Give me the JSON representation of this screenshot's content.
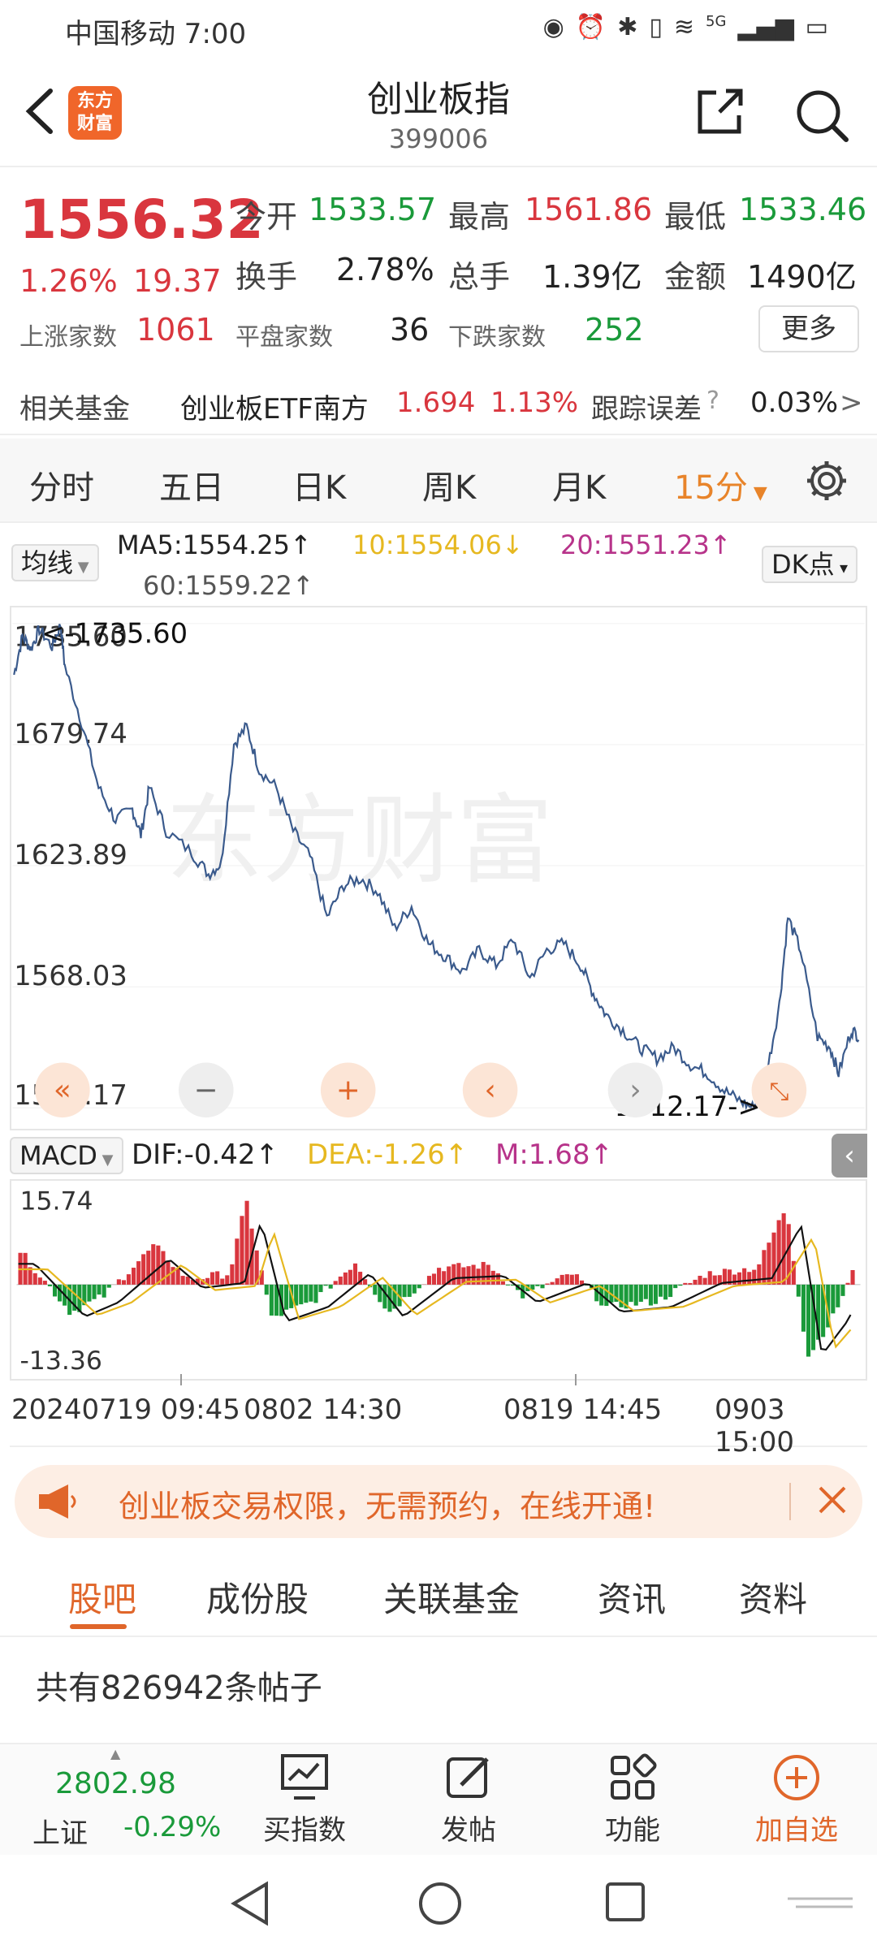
{
  "status_bar": {
    "carrier_time": "中国移动 7:00",
    "signal": "5G"
  },
  "header": {
    "title": "创业板指",
    "code": "399006",
    "logo_line1": "东方",
    "logo_line2": "财富"
  },
  "quote": {
    "price": "1556.32",
    "change_pct": "1.26%",
    "change": "19.37",
    "open_label": "今开",
    "open": "1533.57",
    "high_label": "最高",
    "high": "1561.86",
    "low_label": "最低",
    "low": "1533.46",
    "turnover_label": "换手",
    "turnover": "2.78%",
    "volume_label": "总手",
    "volume": "1.39亿",
    "amount_label": "金额",
    "amount": "1490亿",
    "up_label": "上涨家数",
    "up": "1061",
    "flat_label": "平盘家数",
    "flat": "36",
    "down_label": "下跌家数",
    "down": "252",
    "more": "更多"
  },
  "fund": {
    "label": "相关基金",
    "name": "创业板ETF南方",
    "price": "1.694",
    "pct": "1.13%",
    "err_label": "跟踪误差",
    "err": "0.03%"
  },
  "ktabs": [
    "分时",
    "五日",
    "日K",
    "周K",
    "月K",
    "15分"
  ],
  "ma": {
    "selector": "均线",
    "ma5": "MA5:1554.25↑",
    "ma10": "10:1554.06↓",
    "ma20": "20:1551.23↑",
    "ma60": "60:1559.22↑",
    "dk": "DK点"
  },
  "chart_data": {
    "type": "line",
    "y_ticks": [
      "1735.60",
      "1679.74",
      "1623.89",
      "1568.03",
      "1512.17"
    ],
    "ylim": [
      1512.17,
      1735.6
    ],
    "max_label": "<-1735.60",
    "min_label": "1512.17->",
    "x_labels": [
      "20240719 09:45",
      "0802 14:30",
      "0819 14:45",
      "0903 15:00"
    ],
    "colors": {
      "price": "#3a5a8c",
      "macd_up": "#d9363e",
      "macd_down": "#1a9a3a",
      "dif": "#111111",
      "dea": "#e6b820"
    }
  },
  "macd": {
    "selector": "MACD",
    "dif": "DIF:-0.42↑",
    "dea": "DEA:-1.26↑",
    "m": "M:1.68↑",
    "top": "15.74",
    "bottom": "-13.36"
  },
  "banner": {
    "text": "创业板交易权限，无需预约，在线开通!"
  },
  "btabs": [
    "股吧",
    "成份股",
    "关联基金",
    "资讯",
    "资料"
  ],
  "posts": "共有826942条帖子",
  "bnav": {
    "index_value": "2802.98",
    "index_name": "上证",
    "index_pct": "-0.29%",
    "items": [
      "买指数",
      "发帖",
      "功能",
      "加自选"
    ]
  }
}
